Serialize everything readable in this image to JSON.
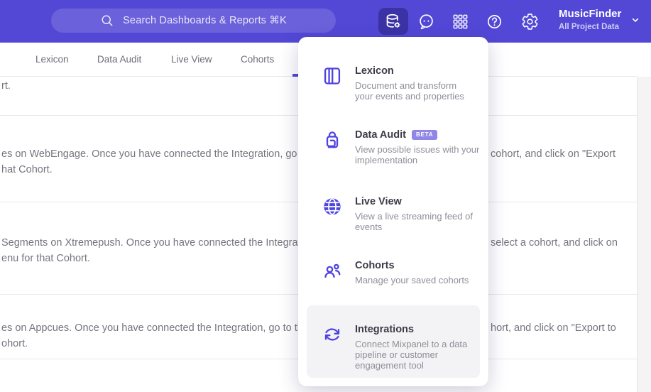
{
  "header": {
    "search_placeholder": "Search Dashboards & Reports ⌘K",
    "project_name": "MusicFinder",
    "project_subtitle": "All Project Data",
    "icons": [
      "search",
      "database-gear",
      "feedback-smiley",
      "apps-grid",
      "help",
      "settings-gear",
      "chevron-down"
    ]
  },
  "tabs": [
    {
      "label": "Lexicon"
    },
    {
      "label": "Data Audit"
    },
    {
      "label": "Live View"
    },
    {
      "label": "Cohorts"
    }
  ],
  "menu": {
    "items": [
      {
        "title": "Lexicon",
        "icon": "book",
        "description": "Document and transform\nyour events and properties"
      },
      {
        "title": "Data Audit",
        "icon": "audit-lock",
        "badge": "BETA",
        "description": "View possible issues with your\nimplementation"
      },
      {
        "title": "Live View",
        "icon": "globe",
        "description": "View a live streaming feed of\nevents"
      },
      {
        "title": "Cohorts",
        "icon": "people",
        "description": "Manage your saved cohorts"
      },
      {
        "title": "Integrations",
        "icon": "sync-arrows",
        "highlighted": true,
        "description": "Connect Mixpanel to a data\npipeline or customer\nengagement tool"
      }
    ]
  },
  "background_rows": [
    {
      "left": "rt.",
      "right": ""
    },
    {
      "left": "es on WebEngage. Once you have connected the Integration, go to the\nhat Cohort.",
      "right": "cohort, and click on \"Export"
    },
    {
      "left": "Segments on Xtremepush. Once you have connected the Integration,\nenu for that Cohort.",
      "right": "select a cohort, and click on"
    },
    {
      "left": "es on Appcues. Once you have connected the Integration, go to the M\nohort.",
      "right": "hort, and click on \"Export to"
    }
  ],
  "colors": {
    "header_bg": "#5348D6",
    "accent": "#4F44E0",
    "beta_badge_bg": "#9186E7",
    "highlight_bg": "#F3F3F5"
  }
}
